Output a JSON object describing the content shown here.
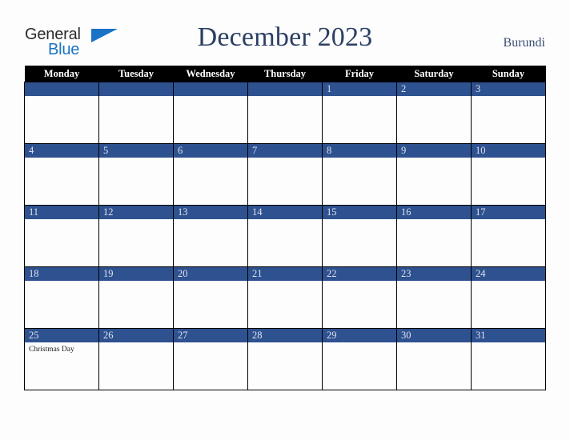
{
  "brand": {
    "name_part1": "General",
    "name_part2": "Blue",
    "triangle_color": "#1a73c4"
  },
  "header": {
    "title": "December 2023",
    "country": "Burundi",
    "title_color": "#2b3f63"
  },
  "calendar": {
    "weekday_headers": [
      "Monday",
      "Tuesday",
      "Wednesday",
      "Thursday",
      "Friday",
      "Saturday",
      "Sunday"
    ],
    "header_bg": "#000000",
    "daynum_bg": "#2e5190",
    "daynum_color": "#dfe3ec",
    "weeks": [
      [
        {
          "day": "",
          "events": []
        },
        {
          "day": "",
          "events": []
        },
        {
          "day": "",
          "events": []
        },
        {
          "day": "",
          "events": []
        },
        {
          "day": "1",
          "events": []
        },
        {
          "day": "2",
          "events": []
        },
        {
          "day": "3",
          "events": []
        }
      ],
      [
        {
          "day": "4",
          "events": []
        },
        {
          "day": "5",
          "events": []
        },
        {
          "day": "6",
          "events": []
        },
        {
          "day": "7",
          "events": []
        },
        {
          "day": "8",
          "events": []
        },
        {
          "day": "9",
          "events": []
        },
        {
          "day": "10",
          "events": []
        }
      ],
      [
        {
          "day": "11",
          "events": []
        },
        {
          "day": "12",
          "events": []
        },
        {
          "day": "13",
          "events": []
        },
        {
          "day": "14",
          "events": []
        },
        {
          "day": "15",
          "events": []
        },
        {
          "day": "16",
          "events": []
        },
        {
          "day": "17",
          "events": []
        }
      ],
      [
        {
          "day": "18",
          "events": []
        },
        {
          "day": "19",
          "events": []
        },
        {
          "day": "20",
          "events": []
        },
        {
          "day": "21",
          "events": []
        },
        {
          "day": "22",
          "events": []
        },
        {
          "day": "23",
          "events": []
        },
        {
          "day": "24",
          "events": []
        }
      ],
      [
        {
          "day": "25",
          "events": [
            "Christmas Day"
          ]
        },
        {
          "day": "26",
          "events": []
        },
        {
          "day": "27",
          "events": []
        },
        {
          "day": "28",
          "events": []
        },
        {
          "day": "29",
          "events": []
        },
        {
          "day": "30",
          "events": []
        },
        {
          "day": "31",
          "events": []
        }
      ]
    ]
  }
}
